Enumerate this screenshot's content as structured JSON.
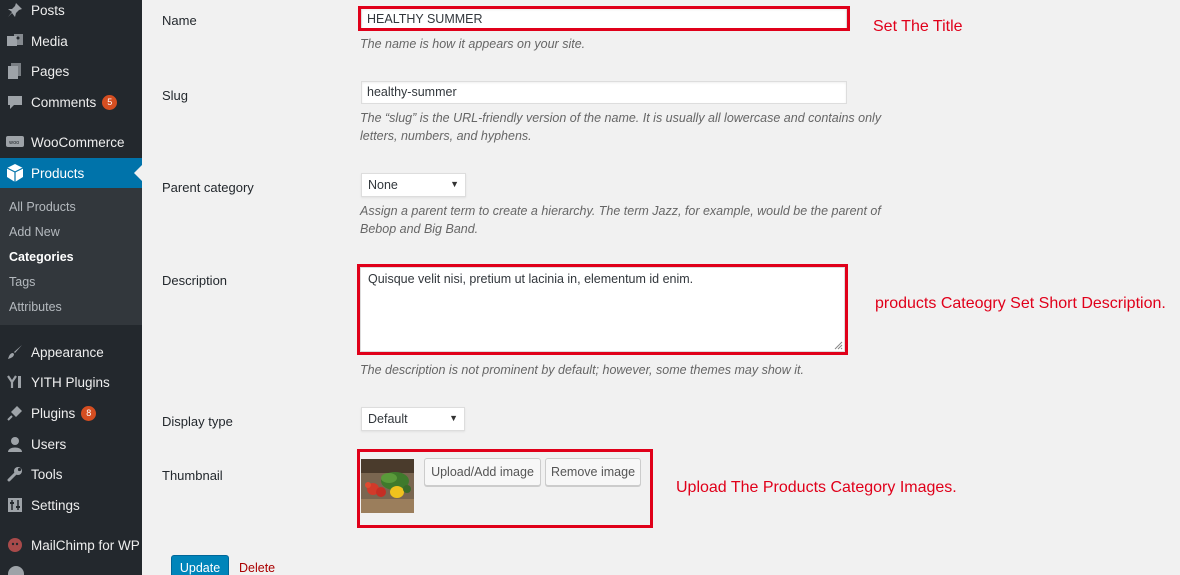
{
  "sidebar": {
    "posts": "Posts",
    "media": "Media",
    "pages": "Pages",
    "comments": "Comments",
    "comments_count": "5",
    "woocommerce": "WooCommerce",
    "products": "Products",
    "submenu": {
      "all_products": "All Products",
      "add_new": "Add New",
      "categories": "Categories",
      "tags": "Tags",
      "attributes": "Attributes"
    },
    "appearance": "Appearance",
    "yith_plugins": "YITH Plugins",
    "plugins": "Plugins",
    "plugins_count": "8",
    "users": "Users",
    "tools": "Tools",
    "settings": "Settings",
    "mailchimp": "MailChimp for WP"
  },
  "form": {
    "name_label": "Name",
    "name_value": "HEALTHY SUMMER",
    "name_help": "The name is how it appears on your site.",
    "slug_label": "Slug",
    "slug_value": "healthy-summer",
    "slug_help_1": "The “slug” is the URL-friendly version of the name. It is usually all lowercase and contains only",
    "slug_help_2": "letters, numbers, and hyphens.",
    "parent_label": "Parent category",
    "parent_value": "None",
    "parent_help_1": "Assign a parent term to create a hierarchy. The term Jazz, for example, would be the parent of",
    "parent_help_2": "Bebop and Big Band.",
    "description_label": "Description",
    "description_value": "Quisque velit nisi, pretium ut lacinia in, elementum id enim.",
    "description_help": "The description is not prominent by default; however, some themes may show it.",
    "display_type_label": "Display type",
    "display_type_value": "Default",
    "thumbnail_label": "Thumbnail",
    "upload_button": "Upload/Add image",
    "remove_button": "Remove image",
    "update_button": "Update",
    "delete_link": "Delete"
  },
  "annotations": {
    "title": "Set The Title",
    "description": "products Cateogry Set Short Description.",
    "images": "Upload The Products Category Images."
  },
  "colors": {
    "sidebar_bg": "#23282d",
    "active_blue": "#0073aa",
    "annotation_red": "#e0001a",
    "badge": "#d54e21"
  }
}
